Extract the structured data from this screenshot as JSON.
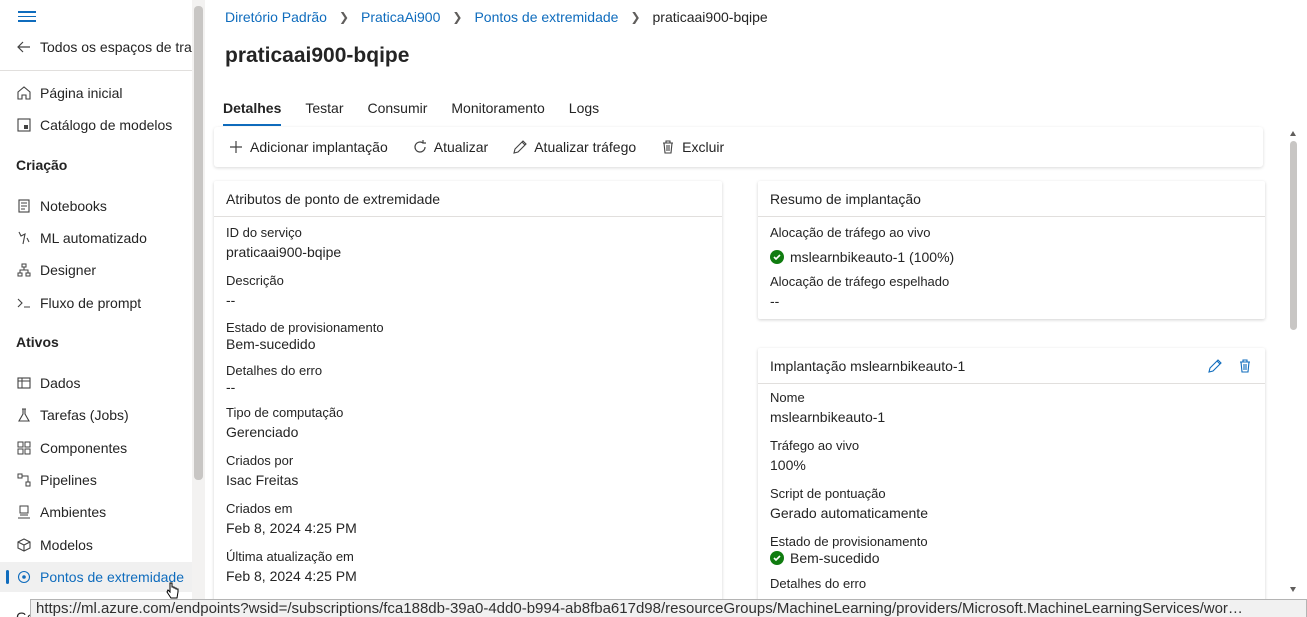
{
  "sidebar": {
    "back_label": "Todos os espaços de trabal",
    "items_top": [
      {
        "label": "Página inicial",
        "icon": "home-icon"
      },
      {
        "label": "Catálogo de modelos",
        "icon": "catalog-icon"
      }
    ],
    "section_creation": "Criação",
    "items_creation": [
      {
        "label": "Notebooks",
        "icon": "notebook-icon"
      },
      {
        "label": "ML automatizado",
        "icon": "automl-icon"
      },
      {
        "label": "Designer",
        "icon": "designer-icon"
      },
      {
        "label": "Fluxo de prompt",
        "icon": "prompt-flow-icon"
      }
    ],
    "section_assets": "Ativos",
    "items_assets": [
      {
        "label": "Dados",
        "icon": "data-icon"
      },
      {
        "label": "Tarefas (Jobs)",
        "icon": "jobs-icon"
      },
      {
        "label": "Componentes",
        "icon": "components-icon"
      },
      {
        "label": "Pipelines",
        "icon": "pipelines-icon"
      },
      {
        "label": "Ambientes",
        "icon": "environments-icon"
      },
      {
        "label": "Modelos",
        "icon": "models-icon"
      },
      {
        "label": "Pontos de extremidade",
        "icon": "endpoints-icon",
        "active": true
      }
    ],
    "partial_next": "Ge"
  },
  "breadcrumb": {
    "items": [
      "Diretório Padrão",
      "PraticaAi900",
      "Pontos de extremidade"
    ],
    "current": "praticaai900-bqipe"
  },
  "page": {
    "title": "praticaai900-bqipe",
    "tabs": [
      "Detalhes",
      "Testar",
      "Consumir",
      "Monitoramento",
      "Logs"
    ],
    "active_tab": "Detalhes"
  },
  "toolbar": {
    "add": "Adicionar implantação",
    "refresh": "Atualizar",
    "update_traffic": "Atualizar tráfego",
    "delete": "Excluir"
  },
  "attributes": {
    "title": "Atributos de ponto de extremidade",
    "service_id_label": "ID do serviço",
    "service_id": "praticaai900-bqipe",
    "description_label": "Descrição",
    "description": "--",
    "provision_label": "Estado de provisionamento",
    "provision": "Bem-sucedido",
    "error_label": "Detalhes do erro",
    "error": "--",
    "compute_label": "Tipo de computação",
    "compute": "Gerenciado",
    "created_by_label": "Criados por",
    "created_by": "Isac Freitas",
    "created_on_label": "Criados em",
    "created_on": "Feb 8, 2024 4:25 PM",
    "updated_label": "Última atualização em",
    "updated": "Feb 8, 2024 4:25 PM"
  },
  "summary": {
    "title": "Resumo de implantação",
    "live_label": "Alocação de tráfego ao vivo",
    "live": "mslearnbikeauto-1 (100%)",
    "mirror_label": "Alocação de tráfego espelhado",
    "mirror": "--"
  },
  "deployment": {
    "title": "Implantação mslearnbikeauto-1",
    "name_label": "Nome",
    "name": "mslearnbikeauto-1",
    "traffic_label": "Tráfego ao vivo",
    "traffic": "100%",
    "script_label": "Script de pontuação",
    "script": "Gerado automaticamente",
    "provision_label": "Estado de provisionamento",
    "provision": "Bem-sucedido",
    "error_label": "Detalhes do erro"
  },
  "status_url": "https://ml.azure.com/endpoints?wsid=/subscriptions/fca188db-39a0-4dd0-b994-ab8fba617d98/resourceGroups/MachineLearning/providers/Microsoft.MachineLearningServices/wor…",
  "colors": {
    "accent": "#0f6cbd",
    "success": "#107c10"
  }
}
